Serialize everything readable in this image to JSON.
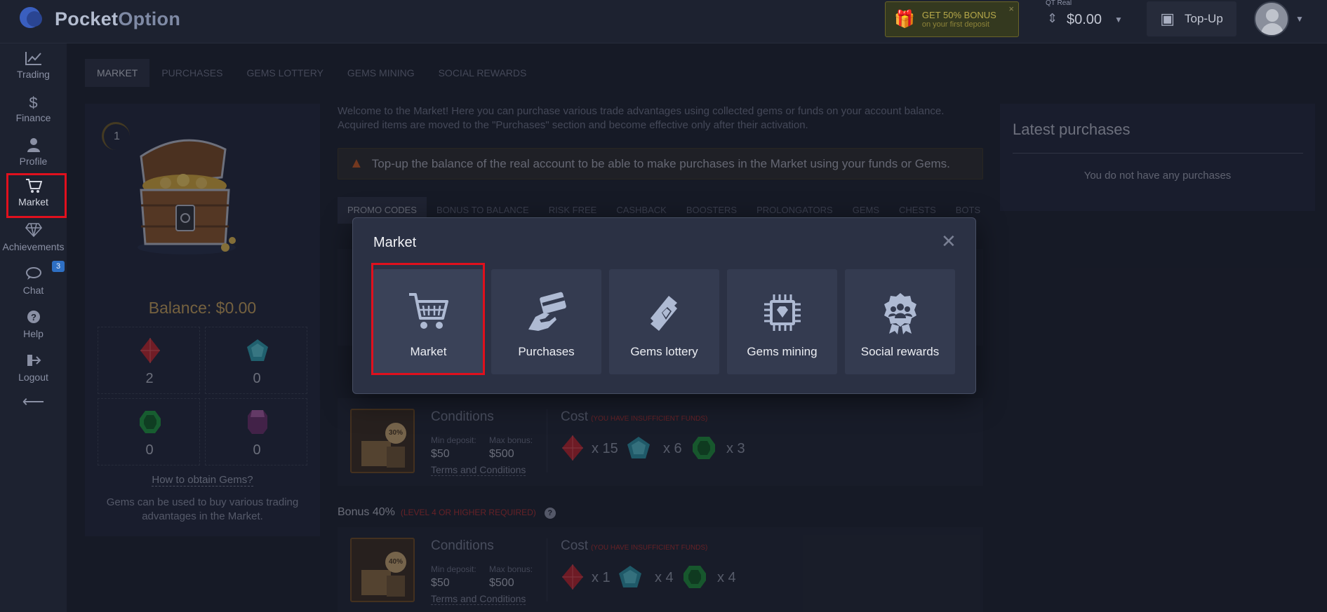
{
  "header": {
    "logo_main": "Pocket",
    "logo_sub": "Option",
    "bonus_line1": "GET 50% BONUS",
    "bonus_line2": "on your first deposit",
    "bonus_close": "×",
    "account_label": "QT Real",
    "account_balance": "$0.00",
    "topup_label": "Top-Up"
  },
  "sidebar": {
    "items": [
      {
        "label": "Trading",
        "icon": "chart-line-icon"
      },
      {
        "label": "Finance",
        "icon": "dollar-icon"
      },
      {
        "label": "Profile",
        "icon": "user-icon"
      },
      {
        "label": "Market",
        "icon": "cart-icon"
      },
      {
        "label": "Achievements",
        "icon": "diamond-icon"
      },
      {
        "label": "Chat",
        "icon": "chat-icon"
      },
      {
        "label": "Help",
        "icon": "help-icon"
      },
      {
        "label": "Logout",
        "icon": "logout-icon"
      }
    ],
    "chat_badge": "3",
    "collapse_glyph": "⟵",
    "active": "Market"
  },
  "nav_tabs": [
    "MARKET",
    "PURCHASES",
    "GEMS LOTTERY",
    "GEMS MINING",
    "SOCIAL REWARDS"
  ],
  "balance_panel": {
    "level": "1",
    "balance_text": "Balance: $0.00",
    "gems": [
      {
        "color": "#c0252d",
        "count": "2"
      },
      {
        "color": "#2c9fb0",
        "count": "0"
      },
      {
        "color": "#1d9a3e",
        "count": "0"
      },
      {
        "color": "#8a3a7a",
        "count": "0"
      }
    ],
    "howto_link": "How to obtain Gems?",
    "info": "Gems can be used to buy various trading advantages in the Market."
  },
  "main": {
    "welcome": "Welcome to the Market! Here you can purchase various trade advantages using collected gems or funds on your account balance. Acquired items are moved to the \"Purchases\" section and become effective only after their activation.",
    "warning": "Top-up the balance of the real account to be able to make purchases in the Market using your funds or Gems.",
    "subtabs": [
      "PROMO CODES",
      "BONUS TO BALANCE",
      "RISK FREE",
      "CASHBACK",
      "BOOSTERS",
      "PROLONGATORS",
      "GEMS",
      "CHESTS",
      "BOTS"
    ],
    "cards": [
      {
        "title": "",
        "thumb_pct": "30%",
        "conditions_label": "Conditions",
        "min_label": "Min deposit:",
        "min_value": "$50",
        "max_label": "Max bonus:",
        "max_value": "$500",
        "terms": "Terms and Conditions",
        "cost_label": "Cost",
        "insufficient": "(YOU HAVE INSUFFICIENT FUNDS)",
        "costs": [
          "x 15",
          "x 6",
          "x 3"
        ]
      },
      {
        "title": "Bonus 40%",
        "requirement": "(LEVEL 4 OR HIGHER REQUIRED)",
        "thumb_pct": "40%",
        "conditions_label": "Conditions",
        "min_label": "Min deposit:",
        "min_value": "$50",
        "max_label": "Max bonus:",
        "max_value": "$500",
        "terms": "Terms and Conditions",
        "cost_label": "Cost",
        "insufficient": "(YOU HAVE INSUFFICIENT FUNDS)",
        "costs": [
          "x 1",
          "x 4",
          "x 4"
        ]
      }
    ]
  },
  "latest": {
    "title": "Latest purchases",
    "empty": "You do not have any purchases"
  },
  "modal": {
    "title": "Market",
    "close": "✕",
    "tiles": [
      {
        "label": "Market",
        "icon": "cart-icon"
      },
      {
        "label": "Purchases",
        "icon": "card-hand-icon"
      },
      {
        "label": "Gems lottery",
        "icon": "ticket-icon"
      },
      {
        "label": "Gems mining",
        "icon": "chip-diamond-icon"
      },
      {
        "label": "Social rewards",
        "icon": "badge-users-icon"
      }
    ]
  }
}
